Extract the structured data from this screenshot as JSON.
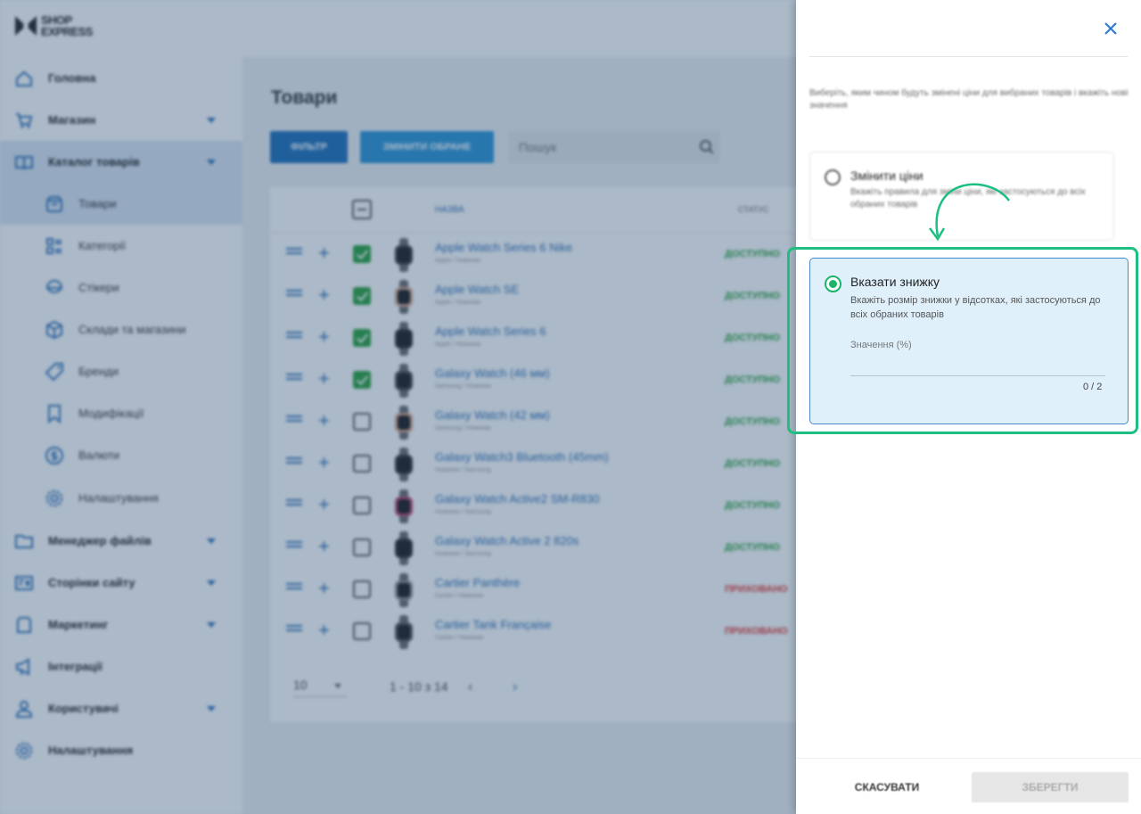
{
  "brand": {
    "line1": "SHOP",
    "line2": "EXPRESS"
  },
  "sidebar": {
    "items": [
      {
        "label": "Головна",
        "icon": "home-icon"
      },
      {
        "label": "Магазин",
        "icon": "cart-icon",
        "expandable": true
      },
      {
        "label": "Каталог товарів",
        "icon": "book-icon",
        "expandable": true,
        "active": true
      },
      {
        "label": "Товари",
        "icon": "box-icon",
        "sub": true,
        "active": true
      },
      {
        "label": "Категорії",
        "icon": "categories-icon",
        "sub": true
      },
      {
        "label": "Стікери",
        "icon": "sticker-icon",
        "sub": true
      },
      {
        "label": "Склади та магазини",
        "icon": "warehouse-icon",
        "sub": true
      },
      {
        "label": "Бренди",
        "icon": "tag-icon",
        "sub": true
      },
      {
        "label": "Модифікації",
        "icon": "bookmark-icon",
        "sub": true
      },
      {
        "label": "Валюти",
        "icon": "currency-icon",
        "sub": true
      },
      {
        "label": "Налаштування",
        "icon": "gear-icon",
        "sub": true
      },
      {
        "label": "Менеджер файлів",
        "icon": "folder-icon",
        "expandable": true
      },
      {
        "label": "Сторінки сайту",
        "icon": "pages-icon",
        "expandable": true
      },
      {
        "label": "Маркетинг",
        "icon": "marketing-icon",
        "expandable": true
      },
      {
        "label": "Інтеграції",
        "icon": "megaphone-icon"
      },
      {
        "label": "Користувачі",
        "icon": "users-icon",
        "expandable": true
      },
      {
        "label": "Налаштування",
        "icon": "settings-icon"
      }
    ]
  },
  "main": {
    "title": "Товари",
    "filter_label": "ФІЛЬТР",
    "edit_selected_label": "ЗМІНИТИ ОБРАНЕ",
    "search_placeholder": "Пошук",
    "table": {
      "col_name": "НАЗВА",
      "col_status": "СТАТУС",
      "rows": [
        {
          "name": "Apple Watch Series 6 Nike",
          "sub": "Apple / Новинки",
          "status": "ДОСТУПНО",
          "checked": true,
          "watch": "#3a3a3a"
        },
        {
          "name": "Apple Watch SE",
          "sub": "Apple / Новинки",
          "status": "ДОСТУПНО",
          "checked": true,
          "watch": "#d9a58a"
        },
        {
          "name": "Apple Watch Series 6",
          "sub": "Apple / Новинки",
          "status": "ДОСТУПНО",
          "checked": true,
          "watch": "#2b2b2b"
        },
        {
          "name": "Galaxy Watch (46 мм)",
          "sub": "Samsung / Новинки",
          "status": "ДОСТУПНО",
          "checked": true,
          "watch": "#444444"
        },
        {
          "name": "Galaxy Watch (42 мм)",
          "sub": "Samsung / Новинки",
          "status": "ДОСТУПНО",
          "checked": false,
          "watch": "#d8a284"
        },
        {
          "name": "Galaxy Watch3 Bluetooth (45mm)",
          "sub": "Новинки / Samsung",
          "status": "ДОСТУПНО",
          "checked": false,
          "watch": "#333333"
        },
        {
          "name": "Galaxy Watch Active2 SM-R830",
          "sub": "Новинки / Samsung",
          "status": "ДОСТУПНО",
          "checked": false,
          "watch": "#c0466e"
        },
        {
          "name": "Galaxy Watch Active 2 820s",
          "sub": "Новинки / Samsung",
          "status": "ДОСТУПНО",
          "checked": false,
          "watch": "#2d2d2d"
        },
        {
          "name": "Cartier Panthère",
          "sub": "Cartier / Новинки",
          "status": "ПРИХОВАНО",
          "checked": false,
          "watch": "#8c8c8c"
        },
        {
          "name": "Cartier Tank Française",
          "sub": "Cartier / Новинки",
          "status": "ПРИХОВАНО",
          "checked": false,
          "watch": "#555555"
        }
      ]
    },
    "pagination": {
      "per_page": "10",
      "range": "1 - 10 з 14"
    }
  },
  "drawer": {
    "instruction": "Виберіть, яким чином будуть змінені ціни для вибраних товарів і вкажіть нові значення",
    "option_change": {
      "title": "Змінити ціни",
      "desc": "Вкажіть правила для зміни ціни, які застосуються до всіх обраних товарів"
    },
    "option_discount": {
      "title": "Вказати знижку",
      "desc": "Вкажіть розмір знижки у відсотках, які застосуються до всіх обраних товарів",
      "field_label": "Значення (%)",
      "field_value": "",
      "counter": "0 / 2"
    },
    "cancel_label": "СКАСУВАТИ",
    "save_label": "ЗБЕРЕГТИ"
  },
  "colors": {
    "primary": "#1e6fb9",
    "accent": "#2b94d6",
    "available": "#2ba23d",
    "hidden": "#e53935",
    "highlight": "#1dbf80",
    "selected_bg": "#dff0fb"
  }
}
